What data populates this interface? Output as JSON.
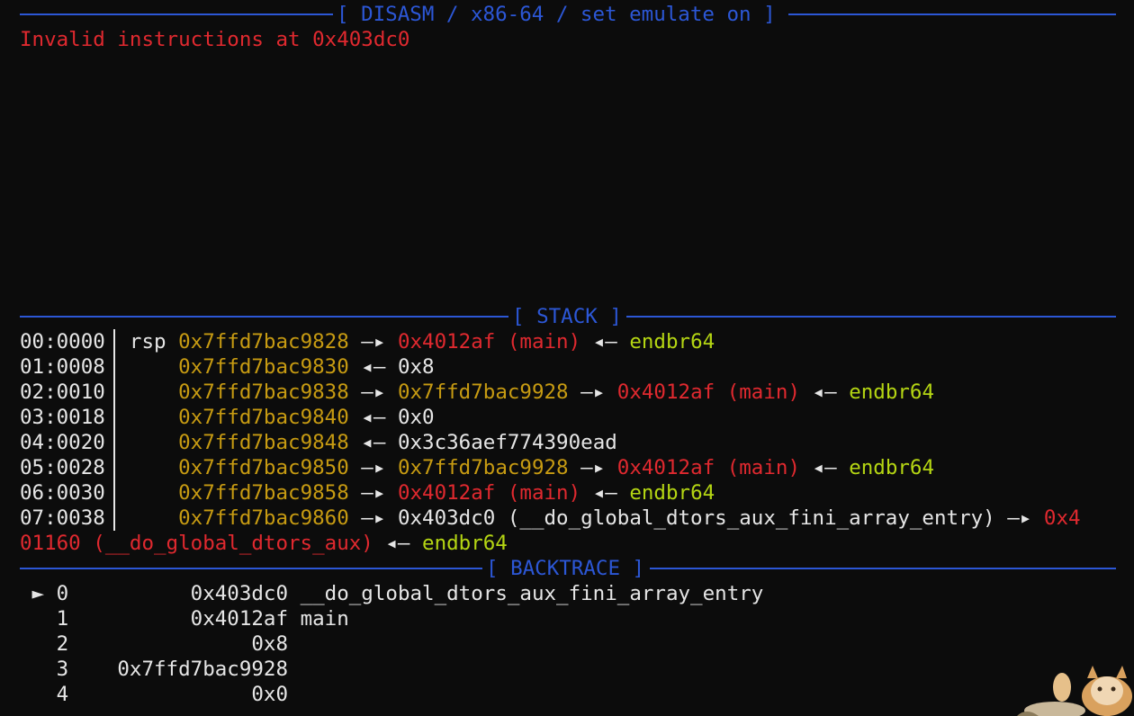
{
  "disasm": {
    "header": "[ DISASM / x86-64 / set emulate on ]",
    "error": "Invalid instructions at 0x403dc0"
  },
  "stack": {
    "header": "[ STACK ]",
    "rows": [
      {
        "offset": "00:0000",
        "reg": "rsp",
        "addr": "0x7ffd7bac9828",
        "chain": [
          {
            "t": " —▸ ",
            "c": "wht"
          },
          {
            "t": "0x4012af (main)",
            "c": "red"
          },
          {
            "t": " ◂— ",
            "c": "wht"
          },
          {
            "t": "endbr64",
            "c": "grn"
          }
        ]
      },
      {
        "offset": "01:0008",
        "reg": "",
        "addr": "0x7ffd7bac9830",
        "chain": [
          {
            "t": " ◂— ",
            "c": "wht"
          },
          {
            "t": "0x8",
            "c": "wht"
          }
        ]
      },
      {
        "offset": "02:0010",
        "reg": "",
        "addr": "0x7ffd7bac9838",
        "chain": [
          {
            "t": " —▸ ",
            "c": "wht"
          },
          {
            "t": "0x7ffd7bac9928",
            "c": "yel"
          },
          {
            "t": " —▸ ",
            "c": "wht"
          },
          {
            "t": "0x4012af (main)",
            "c": "red"
          },
          {
            "t": " ◂— ",
            "c": "wht"
          },
          {
            "t": "endbr64",
            "c": "grn"
          }
        ]
      },
      {
        "offset": "03:0018",
        "reg": "",
        "addr": "0x7ffd7bac9840",
        "chain": [
          {
            "t": " ◂— ",
            "c": "wht"
          },
          {
            "t": "0x0",
            "c": "wht"
          }
        ]
      },
      {
        "offset": "04:0020",
        "reg": "",
        "addr": "0x7ffd7bac9848",
        "chain": [
          {
            "t": " ◂— ",
            "c": "wht"
          },
          {
            "t": "0x3c36aef774390ead",
            "c": "wht"
          }
        ]
      },
      {
        "offset": "05:0028",
        "reg": "",
        "addr": "0x7ffd7bac9850",
        "chain": [
          {
            "t": " —▸ ",
            "c": "wht"
          },
          {
            "t": "0x7ffd7bac9928",
            "c": "yel"
          },
          {
            "t": " —▸ ",
            "c": "wht"
          },
          {
            "t": "0x4012af (main)",
            "c": "red"
          },
          {
            "t": " ◂— ",
            "c": "wht"
          },
          {
            "t": "endbr64",
            "c": "grn"
          }
        ]
      },
      {
        "offset": "06:0030",
        "reg": "",
        "addr": "0x7ffd7bac9858",
        "chain": [
          {
            "t": " —▸ ",
            "c": "wht"
          },
          {
            "t": "0x4012af (main)",
            "c": "red"
          },
          {
            "t": " ◂— ",
            "c": "wht"
          },
          {
            "t": "endbr64",
            "c": "grn"
          }
        ]
      },
      {
        "offset": "07:0038",
        "reg": "",
        "addr": "0x7ffd7bac9860",
        "chain": [
          {
            "t": " —▸ ",
            "c": "wht"
          },
          {
            "t": "0x403dc0 (__do_global_dtors_aux_fini_array_entry)",
            "c": "wht"
          },
          {
            "t": " —▸ ",
            "c": "wht"
          },
          {
            "t": "0x4",
            "c": "red"
          }
        ]
      }
    ],
    "wrap": [
      {
        "t": "01160 (__do_global_dtors_aux)",
        "c": "red"
      },
      {
        "t": " ◂— ",
        "c": "wht"
      },
      {
        "t": "endbr64",
        "c": "grn"
      }
    ]
  },
  "backtrace": {
    "header": "[ BACKTRACE ]",
    "rows": [
      {
        "marker": "►",
        "index": "0",
        "addr": "0x403dc0",
        "sym": "__do_global_dtors_aux_fini_array_entry"
      },
      {
        "marker": "",
        "index": "1",
        "addr": "0x4012af",
        "sym": "main"
      },
      {
        "marker": "",
        "index": "2",
        "addr": "0x8",
        "sym": ""
      },
      {
        "marker": "",
        "index": "3",
        "addr": "0x7ffd7bac9928",
        "sym": ""
      },
      {
        "marker": "",
        "index": "4",
        "addr": "0x0",
        "sym": ""
      }
    ]
  },
  "colors": {
    "rule": "#2c57d6",
    "address": "#c79b12",
    "code": "#e0292f",
    "instr": "#b5d613",
    "text": "#e6e6e6"
  }
}
